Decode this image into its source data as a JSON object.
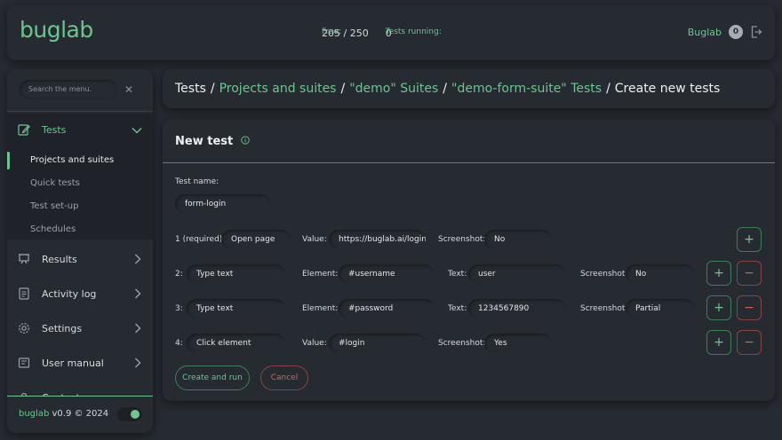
{
  "header": {
    "logo": "buglab",
    "free_label": "Free:",
    "free_value": "205 / 250",
    "running_label": "Tests running:",
    "running_value": "0",
    "user_name": "Buglab",
    "user_badge": "0"
  },
  "sidebar": {
    "search_placeholder": "Search the menu.",
    "items": [
      {
        "label": "Tests",
        "icon": "edit-icon"
      },
      {
        "label": "Results",
        "icon": "easel-icon"
      },
      {
        "label": "Activity log",
        "icon": "document-icon"
      },
      {
        "label": "Settings",
        "icon": "gear-icon"
      },
      {
        "label": "User manual",
        "icon": "book-icon"
      },
      {
        "label": "Contacts",
        "icon": "contact-icon"
      }
    ],
    "sub_items": [
      "Projects and suites",
      "Quick tests",
      "Test set-up",
      "Schedules"
    ],
    "footer_brand": "buglab",
    "footer_version": "v0.9 © 2024"
  },
  "breadcrumb": {
    "root": "Tests",
    "projects": "Projects and suites",
    "suites": "\"demo\" Suites",
    "tests": "\"demo-form-suite\" Tests",
    "current": "Create new tests"
  },
  "form": {
    "title": "New test",
    "test_name_label": "Test name:",
    "test_name_value": "form-login",
    "steps": [
      {
        "index": "1 (required):",
        "action": "Open page",
        "target_label": "Value:",
        "target_value": "https://buglab.ai/login",
        "screenshot_label": "Screenshot:",
        "screenshot_value": "No"
      },
      {
        "index": "2:",
        "action": "Type text",
        "target_label": "Element:",
        "target_value": "#username",
        "text_label": "Text:",
        "text_value": "user",
        "screenshot_label": "Screenshot:",
        "screenshot_value": "No"
      },
      {
        "index": "3:",
        "action": "Type text",
        "target_label": "Element:",
        "target_value": "#password",
        "text_label": "Text:",
        "text_value": "1234567890",
        "screenshot_label": "Screenshot:",
        "screenshot_value": "Partial"
      },
      {
        "index": "4:",
        "action": "Click element",
        "target_label": "Value:",
        "target_value": "#login",
        "screenshot_label": "Screenshot:",
        "screenshot_value": "Yes"
      }
    ],
    "add_symbol": "+",
    "remove_symbol": "−",
    "create_button": "Create and run",
    "cancel_button": "Cancel"
  },
  "colors": {
    "background": "#262a31",
    "accent": "#6cc68f",
    "danger": "#d56262"
  }
}
